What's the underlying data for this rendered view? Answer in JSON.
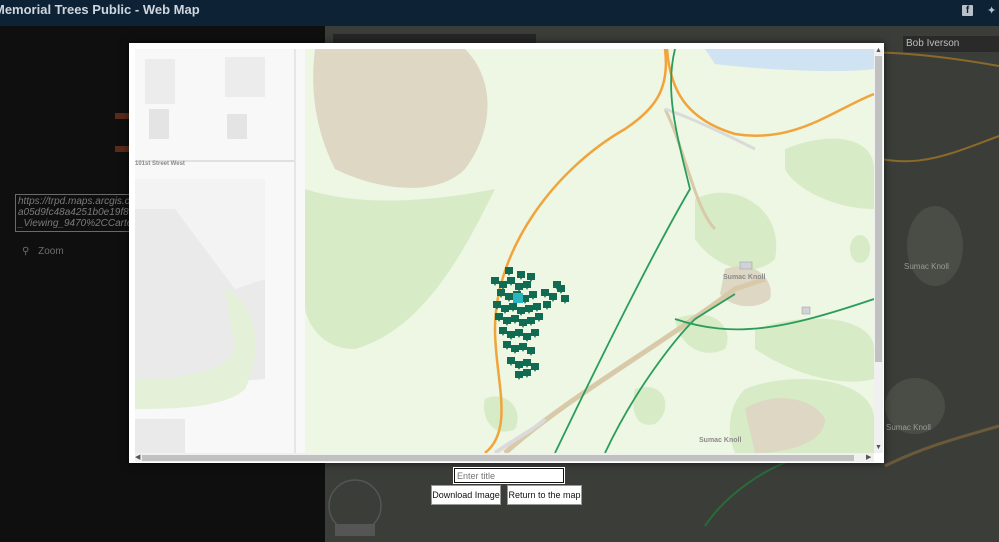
{
  "app": {
    "title": "Memorial Trees Public - Web Map"
  },
  "header_icons": [
    "facebook-icon",
    "twitter-icon"
  ],
  "left_panel": {
    "share_url_lines": [
      "https://trpd.maps.arcgis.co",
      "a05d9fc48a4251b0e19f8",
      "_Viewing_9470%2CCarte"
    ],
    "zoom_label": "Zoom"
  },
  "background_map": {
    "user_name": "Bob Iverson",
    "labels": [
      "Sumac Knoll",
      "Sumac Knoll"
    ]
  },
  "print_preview": {
    "map_labels": {
      "street": "101st Street West",
      "knoll_upper": "Sumac Knoll",
      "knoll_lower": "Sumac Knoll"
    },
    "title_placeholder": "Enter title",
    "download_label": "Download Image",
    "return_label": "Return to the map"
  },
  "colors": {
    "header_bg": "#0e2236",
    "park_green": "#eef6e4",
    "tree_symbol": "#0f6b52",
    "selected_tree": "#2bb5c0",
    "trail_orange": "#f0a43a",
    "path_green": "#2a9d5b"
  }
}
